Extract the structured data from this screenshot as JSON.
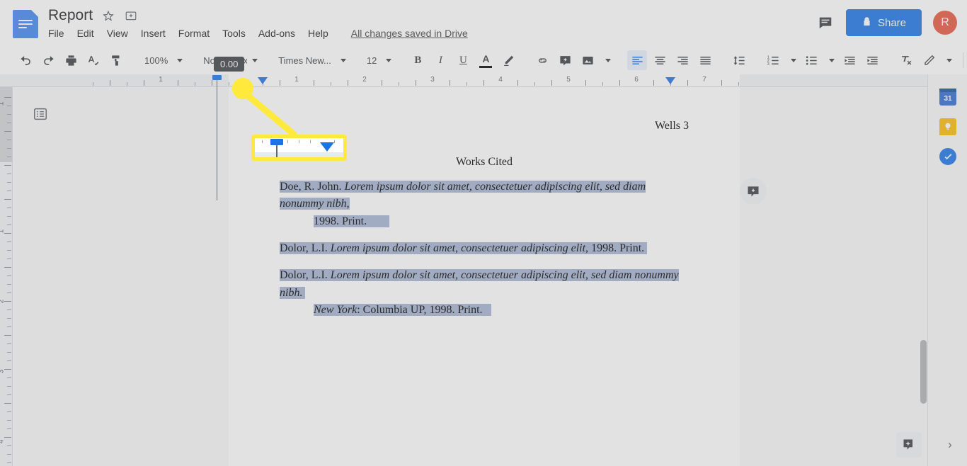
{
  "header": {
    "doc_title": "Report",
    "star_icon": "star-icon",
    "move_icon": "move-to-folder-icon",
    "menus": [
      "File",
      "Edit",
      "View",
      "Insert",
      "Format",
      "Tools",
      "Add-ons",
      "Help"
    ],
    "save_status": "All changes saved in Drive",
    "comment_history_icon": "comment-history-icon",
    "share_label": "Share",
    "share_lock_icon": "lock-icon",
    "avatar_initial": "R",
    "avatar_color": "#e8573f",
    "share_color": "#1a73e8"
  },
  "toolbar": {
    "undo_icon": "undo-icon",
    "redo_icon": "redo-icon",
    "print_icon": "print-icon",
    "spellcheck_icon": "spellcheck-icon",
    "paint_format_icon": "paint-format-icon",
    "zoom_value": "100%",
    "style_value": "Normal text",
    "font_value": "Times New...",
    "font_size_value": "12",
    "bold_label": "B",
    "italic_label": "I",
    "underline_label": "U",
    "text_color_label": "A",
    "text_color_swatch": "#000000",
    "highlight_icon": "highlight-pen-icon",
    "link_icon": "insert-link-icon",
    "add_comment_icon": "add-comment-icon",
    "image_icon": "insert-image-icon",
    "align_left_icon": "align-left-icon",
    "align_center_icon": "align-center-icon",
    "align_right_icon": "align-right-icon",
    "align_justify_icon": "align-justify-icon",
    "line_spacing_icon": "line-spacing-icon",
    "numbered_list_icon": "numbered-list-icon",
    "bulleted_list_icon": "bulleted-list-icon",
    "decrease_indent_icon": "decrease-indent-icon",
    "increase_indent_icon": "increase-indent-icon",
    "clear_formatting_icon": "clear-formatting-icon",
    "edit_mode_icon": "edit-pencil-icon",
    "collapse_icon": "chevron-up-icon",
    "active_alignment": "align-left"
  },
  "tooltip": {
    "text": "0.00"
  },
  "ruler": {
    "horizontal_numbers": [
      "1",
      "1",
      "2",
      "3",
      "4",
      "5",
      "6",
      "7"
    ],
    "vertical_numbers": [
      "1",
      "1",
      "2",
      "3",
      "4"
    ],
    "first_line_indent_marker": "first-line-indent-marker",
    "left_indent_marker": "left-indent-marker",
    "right_indent_marker": "right-indent-marker"
  },
  "annotation": {
    "callout_kind": "magnified-ruler-indent-markers",
    "highlight_color": "#ffe93d"
  },
  "document": {
    "page_header": "Wells 3",
    "section_title": "Works Cited",
    "selection_color": "#a6b5d4",
    "entries": [
      {
        "line1_roman": "Doe, R. John.",
        "line1_italic": "Lorem ipsum dolor sit amet, consectetuer adipiscing elit, sed diam nonummy nibh,",
        "line2": "1998. Print."
      },
      {
        "line1_roman": "Dolor, L.I.",
        "line1_italic": "Lorem ipsum dolor sit amet, consectetuer adipiscing elit,",
        "line1_tail": "1998. Print."
      },
      {
        "line1_roman": "Dolor, L.I.",
        "line1_italic": "Lorem ipsum dolor sit amet, consectetuer adipiscing elit, sed diam nonummy nibh.",
        "line2_italic": "New York",
        "line2_tail": ": Columbia UP, 1998. Print."
      }
    ]
  },
  "sidebar": {
    "outline_icon": "document-outline-icon",
    "floating_add_comment_icon": "add-comment-icon",
    "rail_items": [
      {
        "name": "google-calendar-icon",
        "label": "31",
        "color": "#2e6bd1"
      },
      {
        "name": "google-keep-icon",
        "label": "",
        "color": "#fbbc04"
      },
      {
        "name": "google-tasks-icon",
        "label": "",
        "color": "#1a73e8"
      }
    ],
    "explore_icon": "explore-star-icon",
    "expand_icon": "chevron-right-icon"
  }
}
